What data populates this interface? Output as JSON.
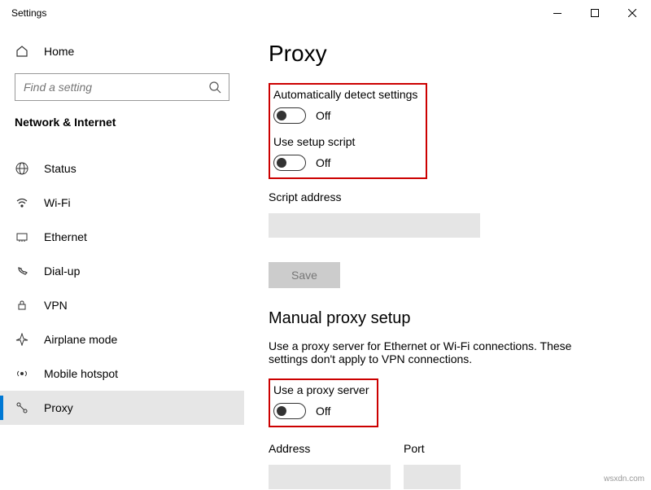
{
  "window": {
    "title": "Settings"
  },
  "sidebar": {
    "home_label": "Home",
    "search_placeholder": "Find a setting",
    "category_label": "Network & Internet",
    "items": [
      {
        "label": "Status"
      },
      {
        "label": "Wi-Fi"
      },
      {
        "label": "Ethernet"
      },
      {
        "label": "Dial-up"
      },
      {
        "label": "VPN"
      },
      {
        "label": "Airplane mode"
      },
      {
        "label": "Mobile hotspot"
      },
      {
        "label": "Proxy"
      }
    ]
  },
  "main": {
    "page_title": "Proxy",
    "auto_detect": {
      "label": "Automatically detect settings",
      "state": "Off"
    },
    "setup_script": {
      "label": "Use setup script",
      "state": "Off"
    },
    "script_address_label": "Script address",
    "save_label": "Save",
    "manual_heading": "Manual proxy setup",
    "manual_desc": "Use a proxy server for Ethernet or Wi-Fi connections. These settings don't apply to VPN connections.",
    "use_proxy": {
      "label": "Use a proxy server",
      "state": "Off"
    },
    "address_label": "Address",
    "port_label": "Port"
  },
  "watermark": "wsxdn.com"
}
